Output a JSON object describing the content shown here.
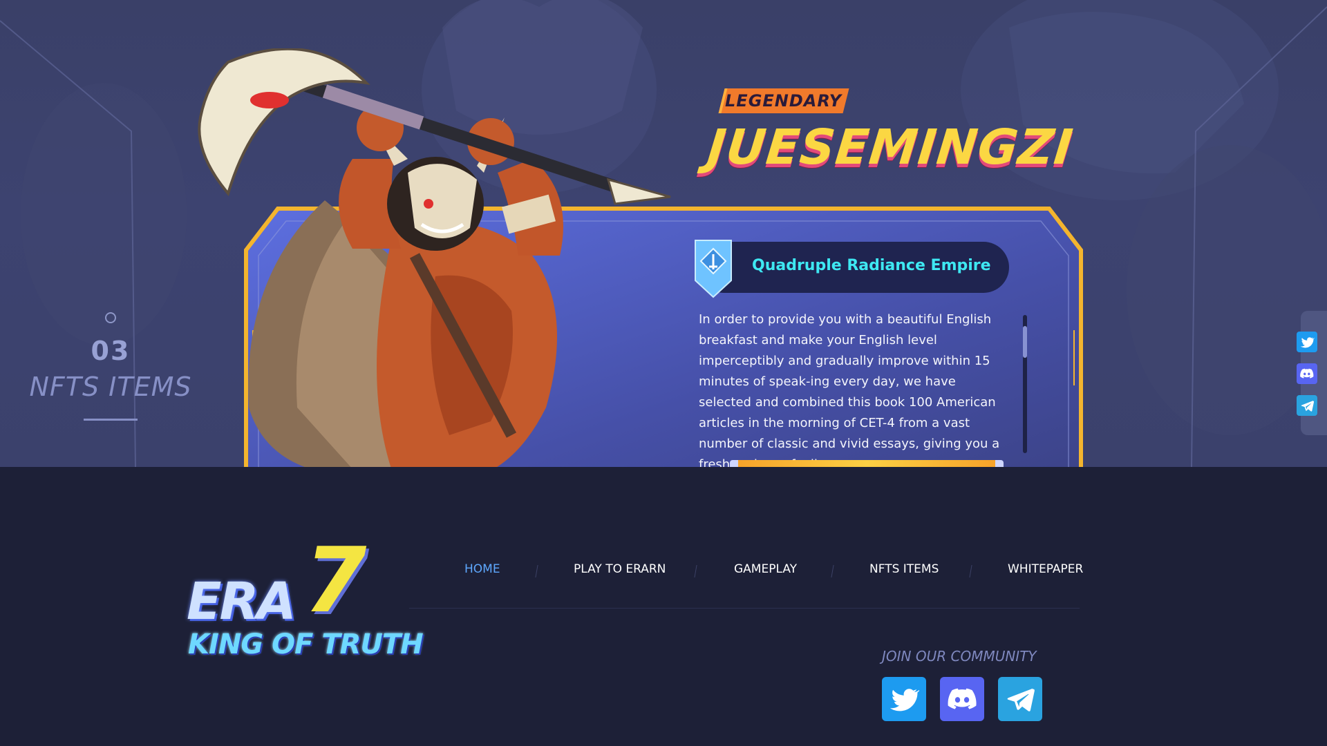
{
  "section": {
    "number": "03",
    "name": "NFTS ITEMS"
  },
  "hero": {
    "rarity": "LEGENDARY",
    "character_name": "JUESEMINGZI",
    "faction": "Quadruple Radiance Empire",
    "description": "In order to provide you with a beautiful English breakfast and make your English level imperceptibly and gradually improve within 15 minutes of speak-ing every day, we have selected and combined this book 100 American articles in the morning of CET-4 from a vast number of classic and vivid essays, giving you a fresh and new feeling."
  },
  "side_social": {
    "items": [
      {
        "icon": "twitter-icon",
        "color": "#1d9bf0"
      },
      {
        "icon": "discord-icon",
        "color": "#5865f2"
      },
      {
        "icon": "telegram-icon",
        "color": "#2aa3e0"
      }
    ]
  },
  "logo": {
    "era": "ERA",
    "seven": "7",
    "tagline": "KING OF TRUTH"
  },
  "nav": {
    "items": [
      {
        "label": "HOME",
        "active": true
      },
      {
        "label": "PLAY TO ERARN",
        "active": false
      },
      {
        "label": "GAMEPLAY",
        "active": false
      },
      {
        "label": "NFTS ITEMS",
        "active": false
      },
      {
        "label": "WHITEPAPER",
        "active": false
      }
    ]
  },
  "community": {
    "title": "JOIN OUR COMMUNITY",
    "items": [
      {
        "icon": "twitter-icon",
        "color": "#1d9bf0"
      },
      {
        "icon": "discord-icon",
        "color": "#5865f2"
      },
      {
        "icon": "telegram-icon",
        "color": "#2aa3e0"
      }
    ]
  },
  "colors": {
    "accent_gold": "#fbd743",
    "rarity_orange": "#f17a2b",
    "faction_cyan": "#3ee8f2",
    "nav_active": "#5ea8ff",
    "footer_bg": "#1d2037"
  }
}
